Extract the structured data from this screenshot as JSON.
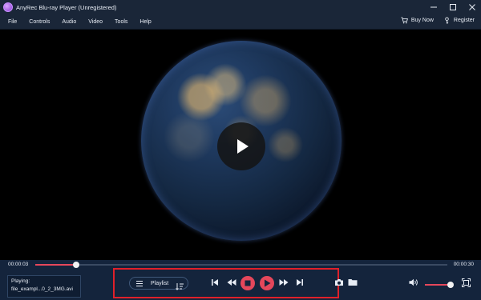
{
  "app": {
    "title": "AnyRec Blu-ray Player (Unregistered)"
  },
  "menu": {
    "items": [
      {
        "label": "File"
      },
      {
        "label": "Controls"
      },
      {
        "label": "Audio"
      },
      {
        "label": "Video"
      },
      {
        "label": "Tools"
      },
      {
        "label": "Help"
      }
    ],
    "buy_now": "Buy Now",
    "register": "Register"
  },
  "playback": {
    "current_time": "00:00:03",
    "total_time": "00:00:30",
    "progress_fraction": 0.1,
    "volume_fraction": 1.0
  },
  "now_playing": {
    "label": "Playing:",
    "file": "file_exampl...0_2_3MG.avi"
  },
  "controls": {
    "playlist_label": "Playlist",
    "accent_color": "#e5475b"
  }
}
